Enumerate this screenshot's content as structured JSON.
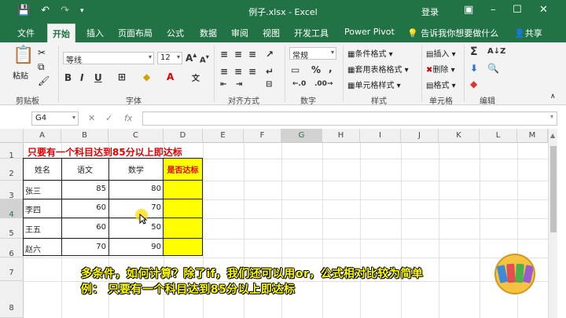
{
  "titlebar": {
    "title": "例子.xlsx  -  Excel",
    "user": "登录",
    "save_icon": "save-icon",
    "undo_icon": "undo-icon",
    "redo_icon": "redo-icon",
    "qat_icon": "customize-qat-icon",
    "min_icon": "minimize-icon",
    "max_icon": "maximize-icon",
    "close_icon": "close-icon"
  },
  "tabs": [
    "文件",
    "开始",
    "插入",
    "页面布局",
    "公式",
    "数据",
    "审阅",
    "视图",
    "开发工具",
    "Power Pivot"
  ],
  "active_tab": "开始",
  "tellme": "告诉我你想要做什么",
  "share": "共享",
  "ribbon": {
    "clipboard": {
      "paste": "粘贴",
      "label": "剪贴板"
    },
    "font": {
      "name": "等线",
      "size": "12",
      "label": "字体",
      "bold": "B",
      "italic": "I",
      "underline": "U"
    },
    "alignment": {
      "label": "对齐方式"
    },
    "number": {
      "format": "常规",
      "percent": "%",
      "comma": ",",
      "label": "数字"
    },
    "styles": {
      "cond": "条件格式",
      "table": "套用表格格式",
      "cell": "单元格样式",
      "label": "样式"
    },
    "cells": {
      "insert": "插入",
      "delete": "删除",
      "format": "格式",
      "label": "单元格"
    },
    "editing": {
      "label": "编辑",
      "sum": "Σ"
    }
  },
  "formula_bar": {
    "name_box": "G4",
    "fx": "fx",
    "value": ""
  },
  "columns": [
    "A",
    "B",
    "C",
    "D",
    "E",
    "F",
    "G",
    "H",
    "I",
    "J",
    "K",
    "L",
    "M"
  ],
  "rows": [
    "1",
    "2",
    "3",
    "4",
    "5",
    "6",
    "7",
    "8"
  ],
  "sheet": {
    "title": "只要有一个科目达到85分以上即达标",
    "headers": [
      "姓名",
      "语文",
      "数学",
      "是否达标"
    ],
    "data": [
      [
        "张三",
        "85",
        "80"
      ],
      [
        "李四",
        "60",
        "70"
      ],
      [
        "王五",
        "60",
        "50"
      ],
      [
        "赵六",
        "70",
        "90"
      ]
    ]
  },
  "subtitles": [
    "多条件，如何计算？除了if，我们还可以用or，公式相对比较为简单",
    "例：  只要有一个科目达到85分以上即达标"
  ],
  "colors": {
    "brand": "#217346",
    "highlight": "#ffff00",
    "title_red": "#e00000"
  }
}
